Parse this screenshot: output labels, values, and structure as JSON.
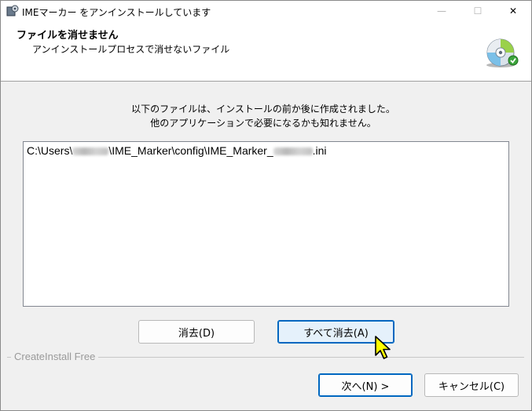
{
  "window": {
    "title": "IMEマーカー をアンインストールしています",
    "minimize_glyph": "—",
    "maximize_glyph": "☐",
    "close_glyph": "✕"
  },
  "header": {
    "title": "ファイルを消せません",
    "subtitle": "アンインストールプロセスで消せないファイル",
    "icon": "cd-disc-icon"
  },
  "message": {
    "line1": "以下のファイルは、インストールの前か後に作成されました。",
    "line2": "他のアプリケーションで必要になるかも知れません。"
  },
  "files": [
    {
      "prefix": "C:\\Users\\",
      "middle": "\\IME_Marker\\config\\IME_Marker_",
      "suffix": ".ini"
    }
  ],
  "buttons": {
    "delete": "消去(D)",
    "delete_all": "すべて消去(A)",
    "next": "次へ(N) >",
    "cancel": "キャンセル(C)"
  },
  "footer": {
    "brand": "CreateInstall Free"
  },
  "colors": {
    "accent": "#0067c0",
    "focus_fill": "#e5f1fb",
    "cursor_fill": "#ffff00"
  }
}
